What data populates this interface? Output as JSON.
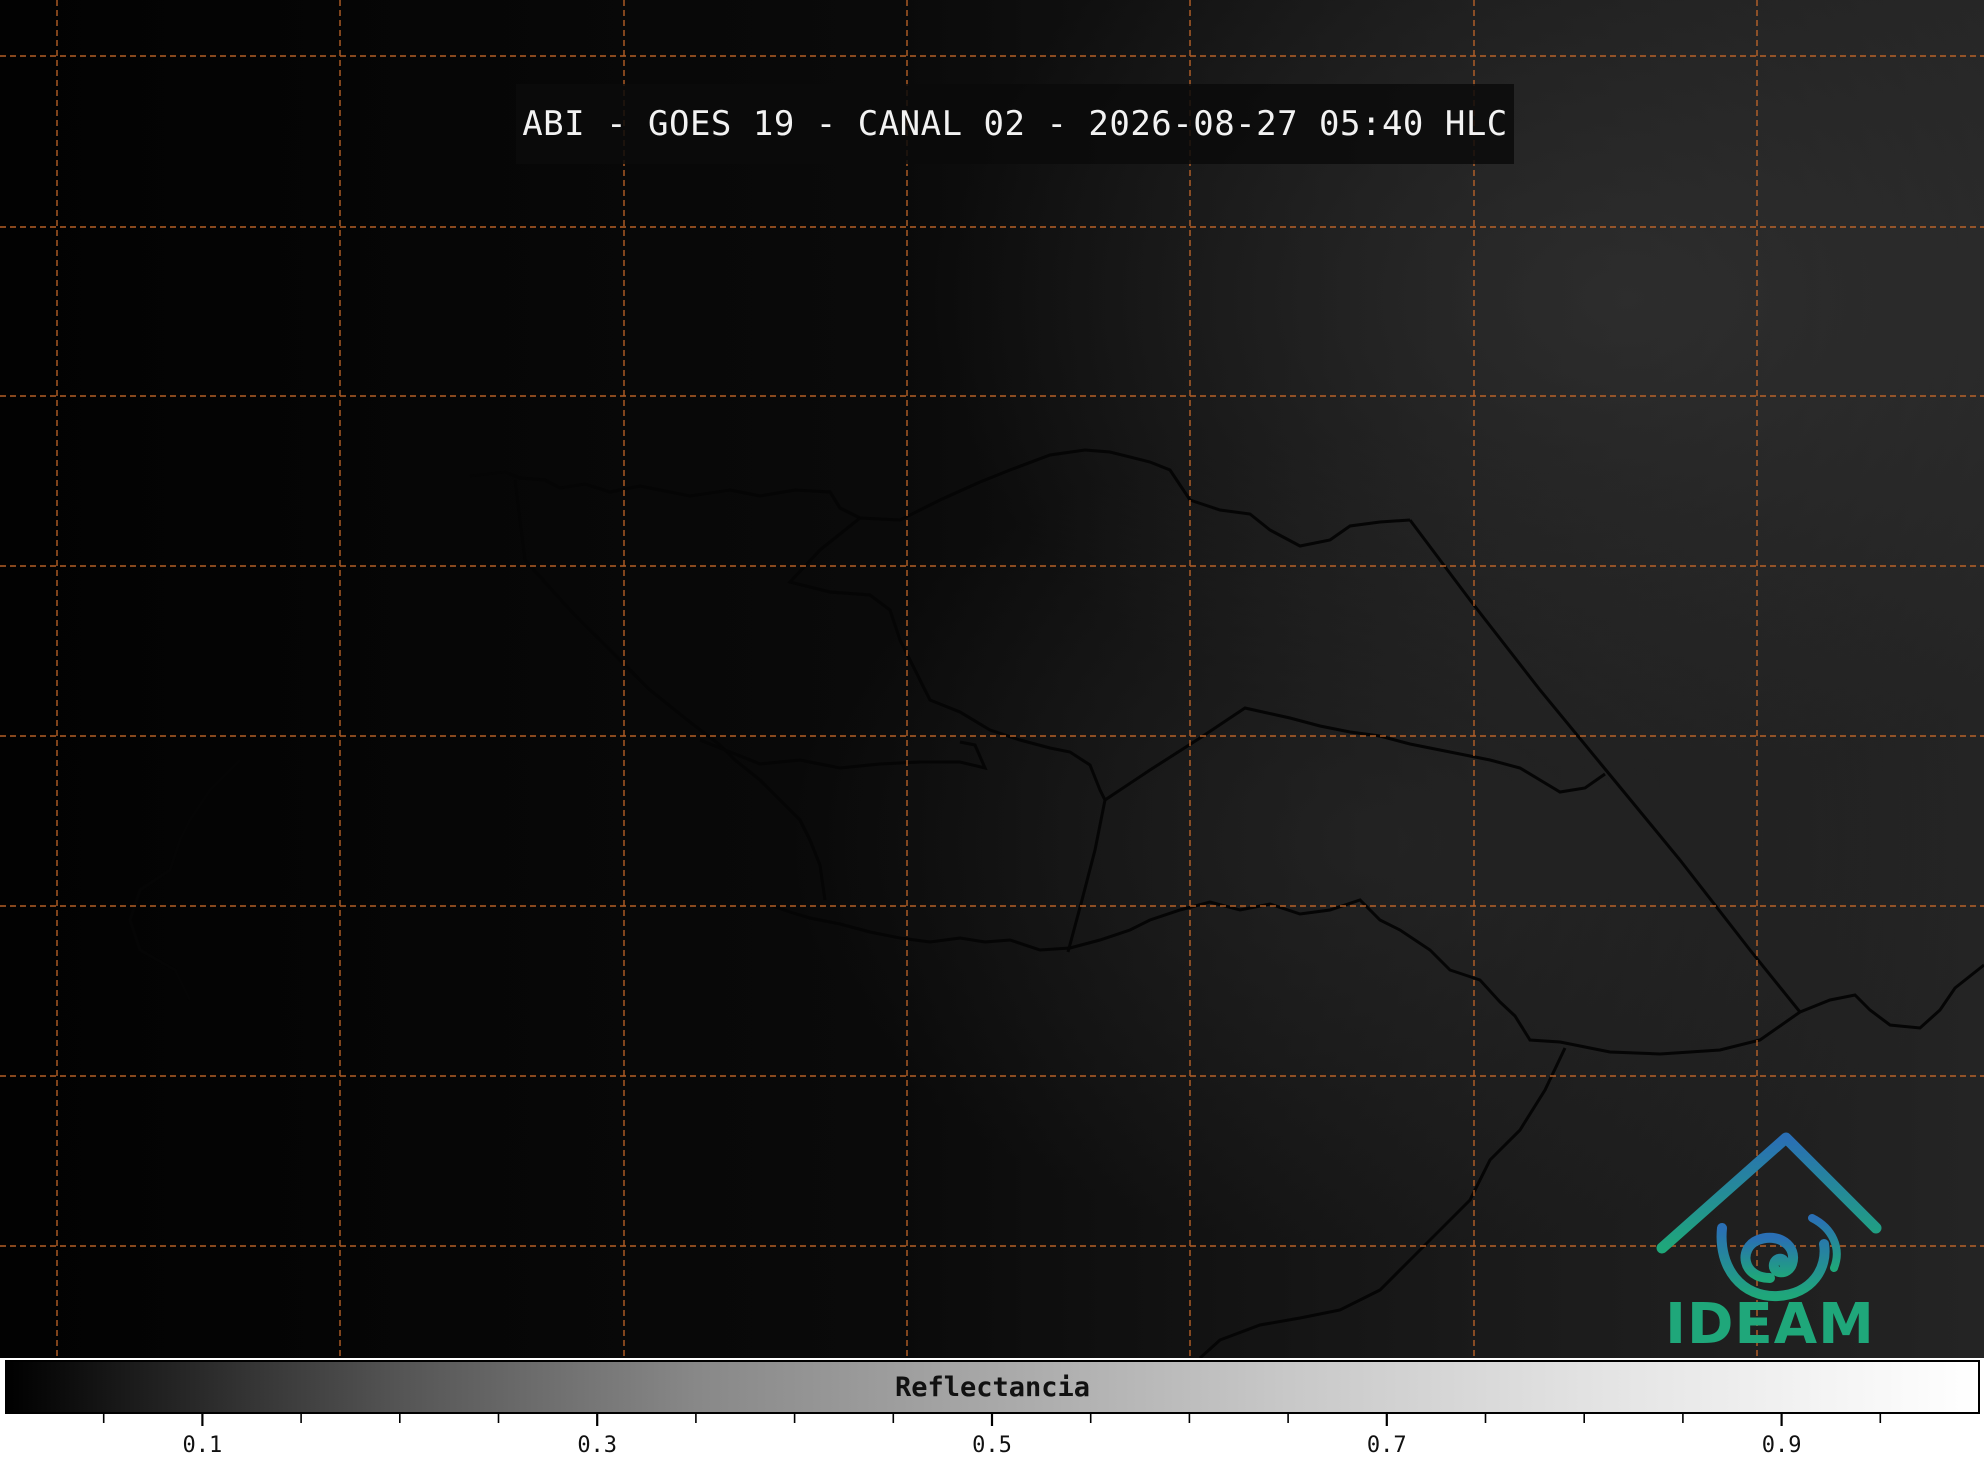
{
  "title": "ABI - GOES 19 - CANAL 02 - 2026-08-27 05:40 HLC",
  "logo": {
    "text": "IDEAM",
    "icon": "ideam-logo-icon",
    "colors": [
      "#2a6fb5",
      "#1fa77a"
    ]
  },
  "colorbar": {
    "label": "Reflectancia",
    "min": 0.0,
    "max": 1.0,
    "tick_labels": [
      {
        "value": 0.1,
        "label": "0.1"
      },
      {
        "value": 0.3,
        "label": "0.3"
      },
      {
        "value": 0.5,
        "label": "0.5"
      },
      {
        "value": 0.7,
        "label": "0.7"
      },
      {
        "value": 0.9,
        "label": "0.9"
      }
    ],
    "minor_step": 0.05
  },
  "colors": {
    "background": "#0b0b0b",
    "gridline": "#c8692a",
    "boundary": "#050505"
  }
}
